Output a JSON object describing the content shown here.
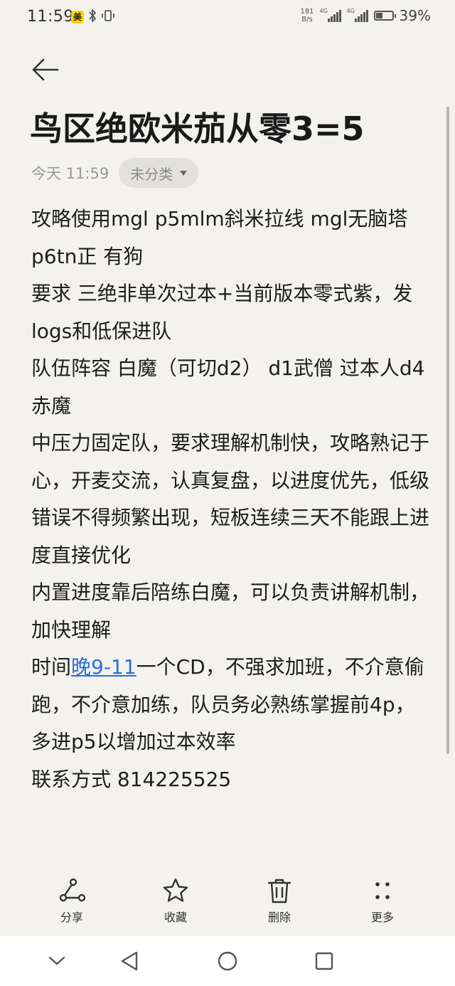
{
  "status_bar": {
    "time": "11:59",
    "app_badge": "美",
    "net_speed_value": "181",
    "net_speed_unit": "B/s",
    "signal1_tag": "4G",
    "signal2_tag": "4G",
    "battery": "39%"
  },
  "note": {
    "title": "鸟区绝欧米茄从零3=5",
    "time": "今天 11:59",
    "category": "未分类",
    "lines": [
      "攻略使用mgl  p5mlm斜米拉线  mgl无脑塔  p6tn正  有狗",
      "要求 三绝非单次过本+当前版本零式紫，发logs和低保进队",
      "队伍阵容  白魔（可切d2）  d1武僧  过本人d4赤魔",
      "中压力固定队，要求理解机制快，攻略熟记于心，开麦交流，认真复盘，以进度优先，低级错误不得频繁出现，短板连续三天不能跟上进度直接优化",
      "内置进度靠后陪练白魔，可以负责讲解机制，加快理解"
    ],
    "schedule_prefix": "时间",
    "schedule_link": "晚9-11",
    "schedule_rest": "一个CD，不强求加班，不介意偷跑，不介意加练，队员务必熟练掌握前4p，多进p5以增加过本效率",
    "contact": "联系方式 814225525"
  },
  "toolbar": {
    "share_label": "分享",
    "favorite_label": "收藏",
    "delete_label": "删除",
    "more_label": "更多"
  },
  "icons": {
    "back": "arrow-left-icon",
    "share": "share-icon",
    "favorite": "star-icon",
    "delete": "trash-icon",
    "more": "more-dots-icon",
    "nav_down": "chevron-down-icon",
    "nav_back": "triangle-back-icon",
    "nav_home": "circle-home-icon",
    "nav_recent": "square-recent-icon"
  },
  "colors": {
    "background": "#f3f2ef",
    "link": "#2a6fdb",
    "text": "#1d1d1d",
    "muted": "#9a9a9a"
  }
}
